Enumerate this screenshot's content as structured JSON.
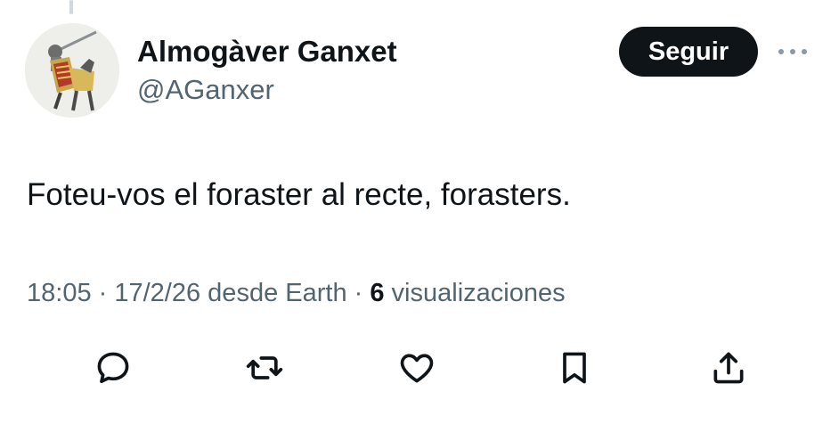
{
  "author": {
    "display_name": "Almogàver Ganxet",
    "handle": "@AGanxer",
    "avatar_icon": "knight-avatar"
  },
  "follow_button": {
    "label": "Seguir"
  },
  "more_button": {
    "icon": "more-horizontal-icon"
  },
  "tweet": {
    "text": "Foteu-vos el foraster al recte, forasters."
  },
  "meta": {
    "time": "18:05",
    "sep1": " · ",
    "date": "17/2/26",
    "source": " desde Earth",
    "sep2": " · ",
    "views_count": "6",
    "views_label": " visualizaciones"
  },
  "actions": [
    {
      "name": "reply",
      "icon": "reply-icon"
    },
    {
      "name": "retweet",
      "icon": "retweet-icon"
    },
    {
      "name": "like",
      "icon": "heart-icon"
    },
    {
      "name": "bookmark",
      "icon": "bookmark-icon"
    },
    {
      "name": "share",
      "icon": "share-icon"
    }
  ],
  "colors": {
    "text_primary": "#0f1419",
    "text_secondary": "#536471",
    "follow_bg": "#0f1419",
    "follow_text": "#ffffff",
    "thread_line": "#cfd9de"
  }
}
